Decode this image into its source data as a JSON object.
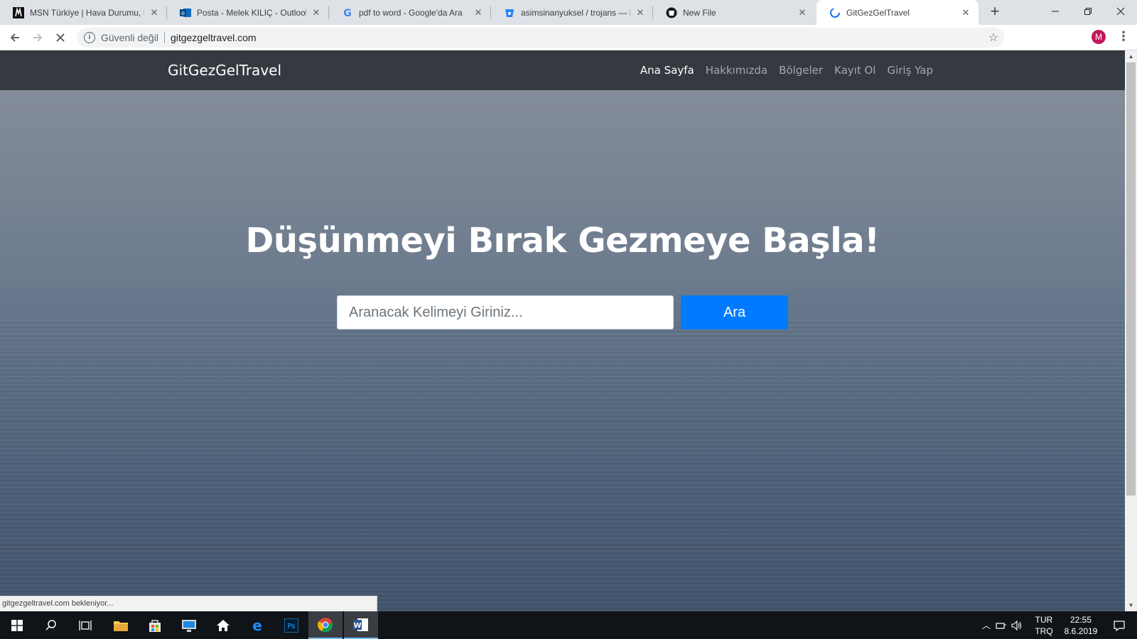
{
  "browser": {
    "tabs": [
      {
        "title": "MSN Türkiye | Hava Durumu, S",
        "icon": "msn-icon"
      },
      {
        "title": "Posta - Melek KILIÇ - Outlook",
        "icon": "outlook-icon"
      },
      {
        "title": "pdf to word - Google'da Ara",
        "icon": "google-icon"
      },
      {
        "title": "asimsinanyuksel / trojans — Bit",
        "icon": "bitbucket-icon"
      },
      {
        "title": "New File",
        "icon": "github-icon"
      },
      {
        "title": "GitGezGelTravel",
        "icon": "loading-spinner-icon",
        "active": true
      }
    ],
    "new_tab_label": "+",
    "address": {
      "security_label": "Güvenli değil",
      "url": "gitgezgeltravel.com"
    },
    "profile_initial": "M",
    "status_text": "gitgezgeltravel.com bekleniyor..."
  },
  "site": {
    "brand": "GitGezGelTravel",
    "nav": [
      "Ana Sayfa",
      "Hakkımızda",
      "Bölgeler",
      "Kayıt Ol",
      "Giriş Yap"
    ],
    "hero_title": "Düşünmeyi Bırak Gezmeye Başla!",
    "search": {
      "placeholder": "Aranacak Kelimeyi Giriniz...",
      "value": ""
    },
    "search_button": "Ara"
  },
  "taskbar": {
    "language": [
      "TUR",
      "TRQ"
    ],
    "time": "22:55",
    "date": "8.6.2019"
  },
  "colors": {
    "navbar": "#343a40",
    "primary_button": "#007bff",
    "tab_strip": "#dee1e6"
  }
}
